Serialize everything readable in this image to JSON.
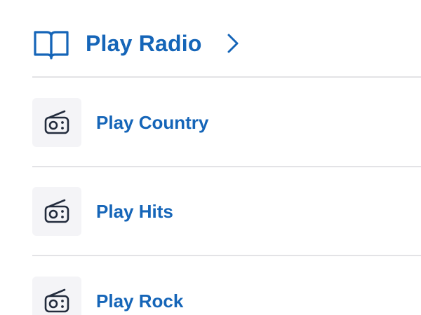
{
  "header": {
    "title": "Play Radio",
    "icon": "book-open-icon",
    "chevron": "chevron-right-icon"
  },
  "stations": [
    {
      "label": "Play Country",
      "icon": "radio-icon"
    },
    {
      "label": "Play Hits",
      "icon": "radio-icon"
    },
    {
      "label": "Play Rock",
      "icon": "radio-icon"
    }
  ],
  "colors": {
    "accent": "#1565b8",
    "icon_dark": "#232c3d",
    "icon_bg": "#f4f4f7",
    "divider": "#e3e3e6"
  }
}
